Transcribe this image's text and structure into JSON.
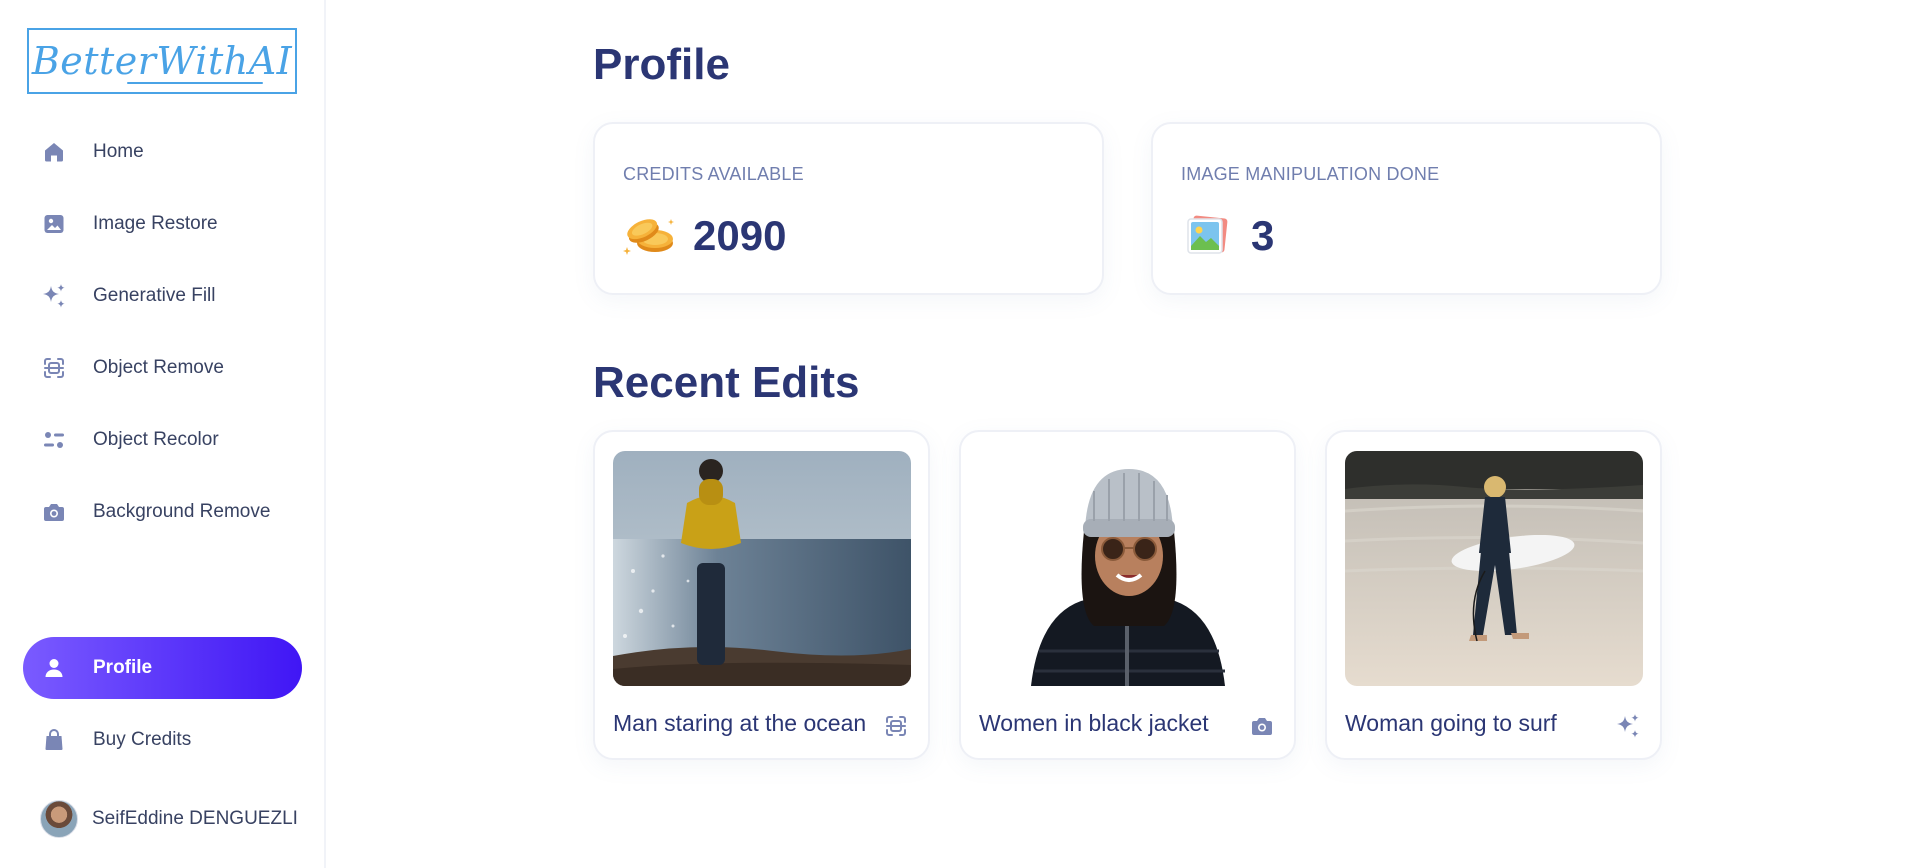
{
  "brand": {
    "logo_text": "BetterWithAI"
  },
  "sidebar": {
    "items": [
      {
        "label": "Home",
        "icon": "home-icon"
      },
      {
        "label": "Image Restore",
        "icon": "image-icon"
      },
      {
        "label": "Generative Fill",
        "icon": "sparkles-icon"
      },
      {
        "label": "Object Remove",
        "icon": "scan-icon"
      },
      {
        "label": "Object Recolor",
        "icon": "sliders-icon"
      },
      {
        "label": "Background Remove",
        "icon": "camera-icon"
      },
      {
        "label": "Profile",
        "icon": "user-icon",
        "active": true
      },
      {
        "label": "Buy Credits",
        "icon": "bag-icon"
      }
    ],
    "user": {
      "name": "SeifEddine DENGUEZLI"
    }
  },
  "main": {
    "title": "Profile",
    "stats": [
      {
        "label": "CREDITS AVAILABLE",
        "value": "2090",
        "icon": "coins-icon"
      },
      {
        "label": "IMAGE MANIPULATION DONE",
        "value": "3",
        "icon": "photos-icon"
      }
    ],
    "recent_title": "Recent Edits",
    "recent": [
      {
        "title": "Man staring at the ocean",
        "icon": "scan-icon"
      },
      {
        "title": "Women in black jacket",
        "icon": "camera-icon"
      },
      {
        "title": "Woman going to surf",
        "icon": "sparkles-icon"
      }
    ]
  },
  "colors": {
    "accent_gradient_start": "#7a5bff",
    "accent_gradient_end": "#4016f5",
    "heading": "#2b3674",
    "icon": "#7a86b5",
    "logo": "#4aa3e6"
  }
}
